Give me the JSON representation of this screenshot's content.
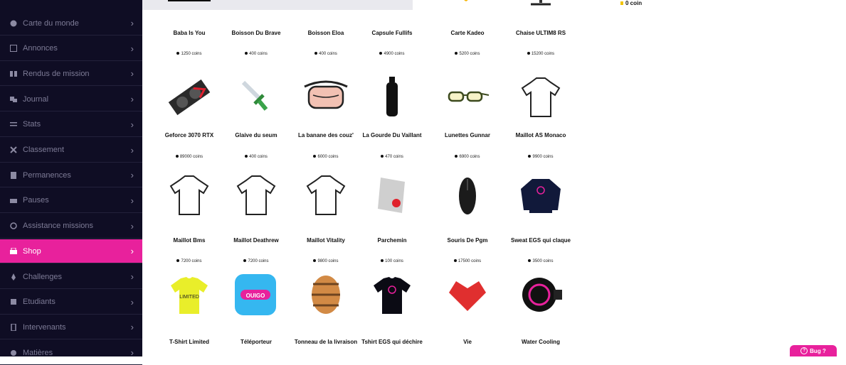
{
  "sidebar": {
    "items": [
      {
        "label": "Carte du monde",
        "icon": "globe-icon"
      },
      {
        "label": "Annonces",
        "icon": "announcement-icon"
      },
      {
        "label": "Rendus de mission",
        "icon": "mission-icon"
      },
      {
        "label": "Journal",
        "icon": "journal-icon"
      },
      {
        "label": "Stats",
        "icon": "stats-icon"
      },
      {
        "label": "Classement",
        "icon": "ranking-icon"
      },
      {
        "label": "Permanences",
        "icon": "calendar-icon"
      },
      {
        "label": "Pauses",
        "icon": "pause-icon"
      },
      {
        "label": "Assistance missions",
        "icon": "help-icon"
      },
      {
        "label": "Shop",
        "icon": "shop-icon"
      },
      {
        "label": "Challenges",
        "icon": "challenge-icon"
      },
      {
        "label": "Etudiants",
        "icon": "students-icon"
      },
      {
        "label": "Intervenants",
        "icon": "speaker-icon"
      },
      {
        "label": "Matières",
        "icon": "subjects-icon"
      }
    ],
    "active_index": 9
  },
  "header": {
    "coins_text": "0 coin"
  },
  "shop": {
    "items": [
      {
        "name": "Baba Is You",
        "price": "1250 coins",
        "icon": "game-icon"
      },
      {
        "name": "Boisson Du Brave",
        "price": "400 coins",
        "icon": "drink-icon"
      },
      {
        "name": "Boisson Eloa",
        "price": "400 coins",
        "icon": "drink-icon"
      },
      {
        "name": "Capsule Fullifs",
        "price": "4900 coins",
        "icon": "capsule-icon"
      },
      {
        "name": "Carte Kadeo",
        "price": "5200 coins",
        "icon": "gift-card-icon"
      },
      {
        "name": "Chaise ULTIM8 RS",
        "price": "15200 coins",
        "icon": "chair-icon"
      },
      {
        "name": "Geforce 3070 RTX",
        "price": "89000 coins",
        "icon": "gpu-icon"
      },
      {
        "name": "Glaive du seum",
        "price": "400 coins",
        "icon": "sword-icon"
      },
      {
        "name": "La banane des couz'",
        "price": "6000 coins",
        "icon": "belt-bag-icon"
      },
      {
        "name": "La Gourde Du Vaillant",
        "price": "470 coins",
        "icon": "bottle-icon"
      },
      {
        "name": "Lunettes Gunnar",
        "price": "6900 coins",
        "icon": "glasses-icon"
      },
      {
        "name": "Maillot AS Monaco",
        "price": "9900 coins",
        "icon": "jersey-icon"
      },
      {
        "name": "Maillot Bms",
        "price": "7200 coins",
        "icon": "jersey-icon"
      },
      {
        "name": "Maillot Deathrew",
        "price": "7200 coins",
        "icon": "jersey-icon"
      },
      {
        "name": "Maillot Vitality",
        "price": "9800 coins",
        "icon": "jersey-icon"
      },
      {
        "name": "Parchemin",
        "price": "100 coins",
        "icon": "scroll-icon"
      },
      {
        "name": "Souris De Pgm",
        "price": "17500 coins",
        "icon": "mouse-icon"
      },
      {
        "name": "Sweat EGS qui claque",
        "price": "3500 coins",
        "icon": "sweater-icon"
      },
      {
        "name": "T-Shirt Limited",
        "price": "",
        "icon": "tshirt-icon"
      },
      {
        "name": "Téléporteur",
        "price": "",
        "icon": "teleporter-icon"
      },
      {
        "name": "Tonneau de la livraison",
        "price": "",
        "icon": "barrel-icon"
      },
      {
        "name": "Tshirt EGS qui déchire",
        "price": "",
        "icon": "tshirt-icon"
      },
      {
        "name": "Vie",
        "price": "",
        "icon": "heart-icon"
      },
      {
        "name": "Water Cooling",
        "price": "",
        "icon": "cooler-icon"
      }
    ]
  },
  "bug_button": {
    "label": "Bug ?"
  },
  "teleporter_logo_text": "OUIGO",
  "tshirt_limited_text": "LIMITED",
  "colors": {
    "accent": "#e8219c",
    "sidebar_bg": "#0f0d24"
  }
}
